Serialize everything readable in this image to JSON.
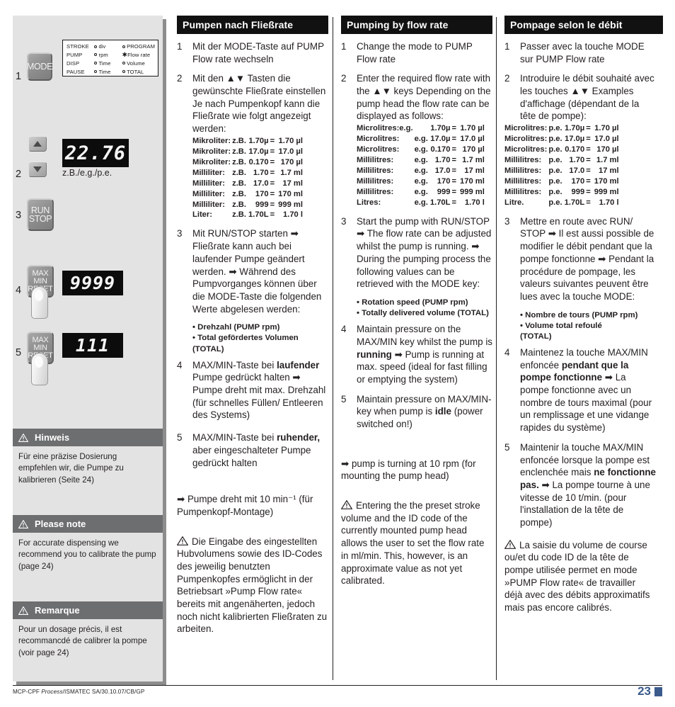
{
  "left_panel": {
    "steps": [
      "1",
      "2",
      "3",
      "4",
      "5"
    ],
    "mode_button_label": "MODE",
    "run_button_line1": "RUN",
    "run_button_line2": "STOP",
    "maxmin_line1": "MAX",
    "maxmin_line2": "MIN",
    "maxmin_line3": "RESET",
    "legend": {
      "rows": [
        {
          "c1": "STROKE",
          "c2": "div",
          "c2_marker": "o",
          "c3": "PROGRAM",
          "c3_marker": "o"
        },
        {
          "c1": "PUMP",
          "c2": "rpm",
          "c2_marker": "o",
          "c3": "Flow rate",
          "c3_marker": "*"
        },
        {
          "c1": "DISP",
          "c2": "Time",
          "c2_marker": "o",
          "c3": "Volume",
          "c3_marker": "o"
        },
        {
          "c1": "PAUSE",
          "c2": "Time",
          "c2_marker": "o",
          "c3": "TOTAL",
          "c3_marker": "o"
        }
      ]
    },
    "lcd_flowrate": "22.76",
    "lcd_caption": "z.B./e.g./p.e.",
    "lcd_max": "9999",
    "lcd_min": "111",
    "notes": [
      {
        "title": "Hinweis",
        "body": "Für eine präzise Dosierung empfehlen wir, die Pumpe zu kalibrieren (Seite 24)"
      },
      {
        "title": "Please note",
        "body": "For accurate dispensing we recommend you to calibrate the pump (page 24)"
      },
      {
        "title": "Remarque",
        "body": "Pour un dosage précis, il est recommancdé de calibrer la pompe (voir page 24)"
      }
    ]
  },
  "column_de": {
    "header": "Pumpen nach Fließrate",
    "step1_num": "1",
    "step1_text": "Mit der MODE-Taste auf PUMP Flow rate wechseln",
    "step2_num": "2",
    "step2_text": "Mit den ▲▼ Tasten die gewünschte Fließrate einstellen Je nach Pumpenkopf kann die Fließrate wie folgt angezeigt werden:",
    "table_rows": [
      {
        "unit": "Mikroliter:",
        "eg": "z.B.",
        "val": "1.70µ",
        "eq": "=",
        "res": "1.70 µl"
      },
      {
        "unit": "Mikroliter:",
        "eg": "z.B.",
        "val": "17.0µ",
        "eq": "=",
        "res": "17.0 µl"
      },
      {
        "unit": "Mikroliter:",
        "eg": "z.B.",
        "val": "0.170",
        "eq": "=",
        "res": "170 µl"
      },
      {
        "unit": "Milliliter:",
        "eg": "z.B.",
        "val": "1.70",
        "eq": "=",
        "res": "1.7 ml"
      },
      {
        "unit": "Milliliter:",
        "eg": "z.B.",
        "val": "17.0",
        "eq": "=",
        "res": "17 ml"
      },
      {
        "unit": "Milliliter:",
        "eg": "z.B.",
        "val": "170",
        "eq": "=",
        "res": "170 ml"
      },
      {
        "unit": "Milliliter:",
        "eg": "z.B.",
        "val": "999",
        "eq": "=",
        "res": "999 ml"
      },
      {
        "unit": "Liter:",
        "eg": "z.B.",
        "val": "1.70L",
        "eq": "=",
        "res": "1.70 l"
      }
    ],
    "step3_num": "3",
    "step3_text": "Mit RUN/STOP starten ➡ Fließrate kann auch bei laufender Pumpe geändert werden. ➡ Während des Pumpvorganges können über die MODE-Taste die folgenden Werte abgelesen werden:",
    "bullets": "• Drehzahl (PUMP rpm)\n• Total gefördertes Volumen (TOTAL)",
    "step4_num": "4",
    "step4_pre": "MAX/MIN-Taste bei ",
    "step4_bold": "laufender",
    "step4_post": " Pumpe gedrückt halten ➡ Pumpe dreht mit max. Drehzahl (für schnelles Füllen/ Entleeren des Systems)",
    "step5_num": "5",
    "step5_pre": "MAX/MIN-Taste bei ",
    "step5_bold": "ruhender,",
    "step5_post": " aber eingeschalteter Pumpe gedrückt halten",
    "arrow_note": "➡ Pumpe dreht mit 10 min⁻¹ (für Pumpenkopf-Montage)",
    "warning": "Die Eingabe des eingestellten Hubvolumens sowie des ID-Codes des jeweilig benutzten Pumpenkopfes ermöglicht in der Betriebsart »Pump Flow rate« bereits mit angenäherten, jedoch noch nicht kalibrierten Fließraten zu arbeiten."
  },
  "column_en": {
    "header": "Pumping by flow rate",
    "step1_num": "1",
    "step1_text": "Change the mode to PUMP Flow rate",
    "step2_num": "2",
    "step2_text": "Enter the required flow rate with the ▲▼ keys Depending on the pump head the flow rate can be displayed as follows:",
    "table_rows": [
      {
        "unit": "Microlitres:e.g.",
        "eg": "",
        "val": "1.70µ",
        "eq": "=",
        "res": "1.70 µl"
      },
      {
        "unit": "Microlitres:",
        "eg": "e.g.",
        "val": "17.0µ",
        "eq": "=",
        "res": "17.0 µl"
      },
      {
        "unit": "Microlitres:",
        "eg": "e.g.",
        "val": "0.170",
        "eq": "=",
        "res": "170 µl"
      },
      {
        "unit": "Millilitres:",
        "eg": "e.g.",
        "val": "1.70",
        "eq": "=",
        "res": "1.7 ml"
      },
      {
        "unit": "Millilitres:",
        "eg": "e.g.",
        "val": "17.0",
        "eq": "=",
        "res": "17 ml"
      },
      {
        "unit": "Millilitres:",
        "eg": "e.g.",
        "val": "170",
        "eq": "=",
        "res": "170 ml"
      },
      {
        "unit": "Millilitres:",
        "eg": "e.g.",
        "val": "999",
        "eq": "=",
        "res": "999 ml"
      },
      {
        "unit": "Litres:",
        "eg": "e.g.",
        "val": "1.70L",
        "eq": "=",
        "res": "1.70 l"
      }
    ],
    "step3_num": "3",
    "step3_text": "Start the pump with RUN/STOP ➡ The flow rate can be adjusted whilst the pump is running. ➡ During the pumping process the following values can be retrieved with the MODE key:",
    "bullets": "• Rotation speed (PUMP rpm)\n• Totally delivered volume (TOTAL)",
    "step4_num": "4",
    "step4_pre": "Maintain pressure on the MAX/MIN key whilst the pump is ",
    "step4_bold": "running",
    "step4_post": " ➡ Pump is running at max. speed  (ideal for fast filling or emptying the system)",
    "step5_num": "5",
    "step5_pre": "Maintain pressure on MAX/MIN-key when pump is ",
    "step5_bold": "idle",
    "step5_post": " (power switched on!)",
    "arrow_note": "➡ pump is turning at 10 rpm (for mounting the pump head)",
    "warning": "Entering the the preset stroke volume and the ID code of the currently mounted pump head allows the user to set the flow rate in ml/min. This, however, is an approximate value as not yet calibrated."
  },
  "column_fr": {
    "header": "Pompage selon le débit",
    "step1_num": "1",
    "step1_text": "Passer avec la touche MODE sur PUMP Flow rate",
    "step2_num": "2",
    "step2_text": "Introduire le débit souhaité avec les touches ▲▼ Examples d'affichage (dépendant de la tête de pompe):",
    "table_rows": [
      {
        "unit": "Microlitres:",
        "eg": "p.e.",
        "val": "1.70µ",
        "eq": "=",
        "res": "1.70 µl"
      },
      {
        "unit": "Microlitres:",
        "eg": "p.e.",
        "val": "17.0µ",
        "eq": "=",
        "res": "17.0 µl"
      },
      {
        "unit": "Microlitres:",
        "eg": "p.e.",
        "val": "0.170",
        "eq": "=",
        "res": "170 µl"
      },
      {
        "unit": "Millilitres:",
        "eg": "p.e.",
        "val": "1.70",
        "eq": "=",
        "res": "1.7 ml"
      },
      {
        "unit": "Millilitres:",
        "eg": "p.e.",
        "val": "17.0",
        "eq": "=",
        "res": "17 ml"
      },
      {
        "unit": "Millilitres:",
        "eg": "p.e.",
        "val": "170",
        "eq": "=",
        "res": "170 ml"
      },
      {
        "unit": "Millilitres:",
        "eg": "p.e.",
        "val": "999",
        "eq": "=",
        "res": "999 ml"
      },
      {
        "unit": "Litre.",
        "eg": "p.e.",
        "val": "1.70L",
        "eq": "=",
        "res": "1.70 l"
      }
    ],
    "step3_num": "3",
    "step3_text": "Mettre en route avec RUN/ STOP ➡ Il est aussi possible de modifier le débit pendant que la pompe fonctionne ➡ Pendant la procédure de pompage, les valeurs suivantes peuvent être lues avec la touche MODE:",
    "bullets": "• Nombre de tours (PUMP rpm)\n• Volume total  refoulé\n(TOTAL)",
    "step4_num": "4",
    "step4_pre": "Maintenez la touche MAX/MIN enfoncée ",
    "step4_bold": "pendant que la pompe fonctionne",
    "step4_post": " ➡ La pompe fonctionne avec un nombre de tours maximal (pour un remplissage et une vidange rapides du système)",
    "step5_num": "5",
    "step5_pre": "Maintenir la touche MAX/MIN enfoncée lorsque la pompe est enclenchée mais ",
    "step5_bold": "ne fonctionne pas.",
    "step5_post": " ➡ La pompe tourne à une vitesse de 10 t/min. (pour l'installation de la tête de pompe)",
    "warning": "La saisie du volume de course ou/et du code ID de la tête de pompe utilisée permet en mode »PUMP Flow rate« de travailler déjà avec des débits approximatifs mais pas encore calibrés."
  },
  "footer": {
    "left_pre": "MCP-CPF ",
    "left_italic": "Process",
    "left_post": "/ISMATEC SA/30.10.07/CB/GP",
    "page_number": "23"
  },
  "colors": {
    "panel_bg": "#e3e3e3",
    "note_header": "#6d6e70",
    "column_header": "#111111",
    "page_accent": "#3b5b8c",
    "lcd_bg": "#0c0c0c"
  }
}
